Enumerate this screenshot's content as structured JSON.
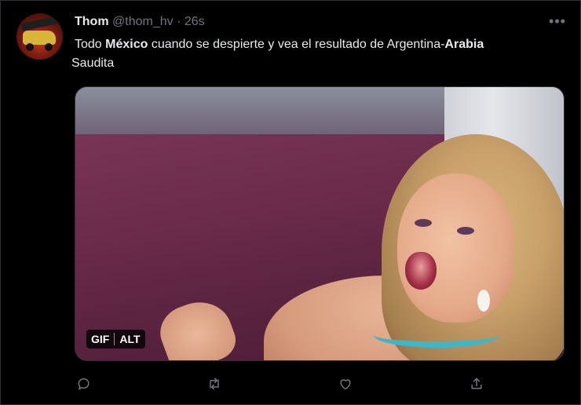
{
  "tweet": {
    "author_name": "Thom",
    "handle": "@thom_hv",
    "separator": "·",
    "timestamp": "26s",
    "more_icon": "more-horizontal-icon",
    "text_parts": [
      {
        "text": "Todo ",
        "bold": false
      },
      {
        "text": "México",
        "bold": true
      },
      {
        "text": " cuando se despierte y vea el resultado de Argentina-",
        "bold": false
      },
      {
        "text": "Arabia",
        "bold": true
      },
      {
        "text": " Saudita",
        "bold": false
      }
    ]
  },
  "media": {
    "gif_badge": "GIF",
    "alt_badge": "ALT"
  },
  "actions": {
    "reply_icon": "reply-icon",
    "retweet_icon": "retweet-icon",
    "like_icon": "heart-icon",
    "share_icon": "share-icon"
  },
  "colors": {
    "background": "#000000",
    "text_primary": "#e7e9ea",
    "text_secondary": "#71767b",
    "border": "#2f3336"
  }
}
